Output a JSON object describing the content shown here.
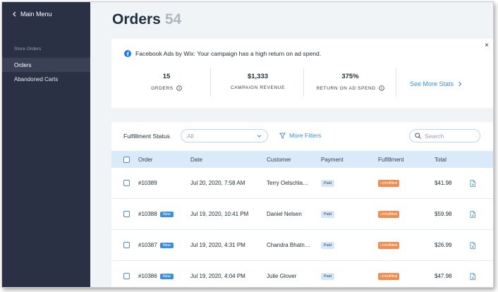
{
  "sidebar": {
    "back_label": "Main Menu",
    "section_label": "Store Orders",
    "items": [
      {
        "label": "Orders",
        "active": true
      },
      {
        "label": "Abandoned Carts",
        "active": false
      }
    ]
  },
  "header": {
    "title": "Orders",
    "count": "54"
  },
  "promo": {
    "message": "Facebook Ads by Wix: Your campaign has a high return on ad spend.",
    "close_label": "×",
    "stats": [
      {
        "value": "15",
        "label": "ORDERS"
      },
      {
        "value": "$1,333",
        "label": "CAMPAIGN REVENUE"
      },
      {
        "value": "375%",
        "label": "RETURN ON AD SPEND"
      }
    ],
    "see_more_label": "See More Stats"
  },
  "filters": {
    "fulfillment_label": "Fulfillment Status",
    "fulfillment_value": "All",
    "more_filters_label": "More Filters",
    "search_placeholder": "Search"
  },
  "table": {
    "columns": [
      "Order",
      "Date",
      "Customer",
      "Payment",
      "Fulfillment",
      "Total"
    ],
    "rows": [
      {
        "order": "#10389",
        "is_new": false,
        "new_label": "",
        "date": "Jul 20, 2020, 7:58 AM",
        "customer": "Terry Oelschla…",
        "payment": "Paid",
        "fulfillment": "Unfulfilled",
        "total": "$41.98"
      },
      {
        "order": "#10388",
        "is_new": true,
        "new_label": "New",
        "date": "Jul 19, 2020, 10:41 PM",
        "customer": "Daniel Nelsen",
        "payment": "Paid",
        "fulfillment": "Unfulfilled",
        "total": "$59.98"
      },
      {
        "order": "#10387",
        "is_new": true,
        "new_label": "New",
        "date": "Jul 19, 2020, 4:31 PM",
        "customer": "Chandra Bhatn…",
        "payment": "Paid",
        "fulfillment": "Unfulfilled",
        "total": "$26.99"
      },
      {
        "order": "#10386",
        "is_new": true,
        "new_label": "New",
        "date": "Jul 19, 2020, 4:04 PM",
        "customer": "Julie Glover",
        "payment": "Paid",
        "fulfillment": "Unfulfilled",
        "total": "$47.98"
      }
    ]
  },
  "colors": {
    "sidebar_bg": "#2b3144",
    "accent": "#3b8fe0",
    "unfulfilled": "#f28c4d",
    "header_row_bg": "#daeaf8"
  },
  "icons": {
    "back": "chevron-left-icon",
    "facebook": "facebook-icon",
    "info": "info-icon",
    "see_more": "chevron-right-icon",
    "dropdown": "chevron-down-icon",
    "filter": "filter-icon",
    "search": "search-icon",
    "invoice": "document-icon"
  }
}
